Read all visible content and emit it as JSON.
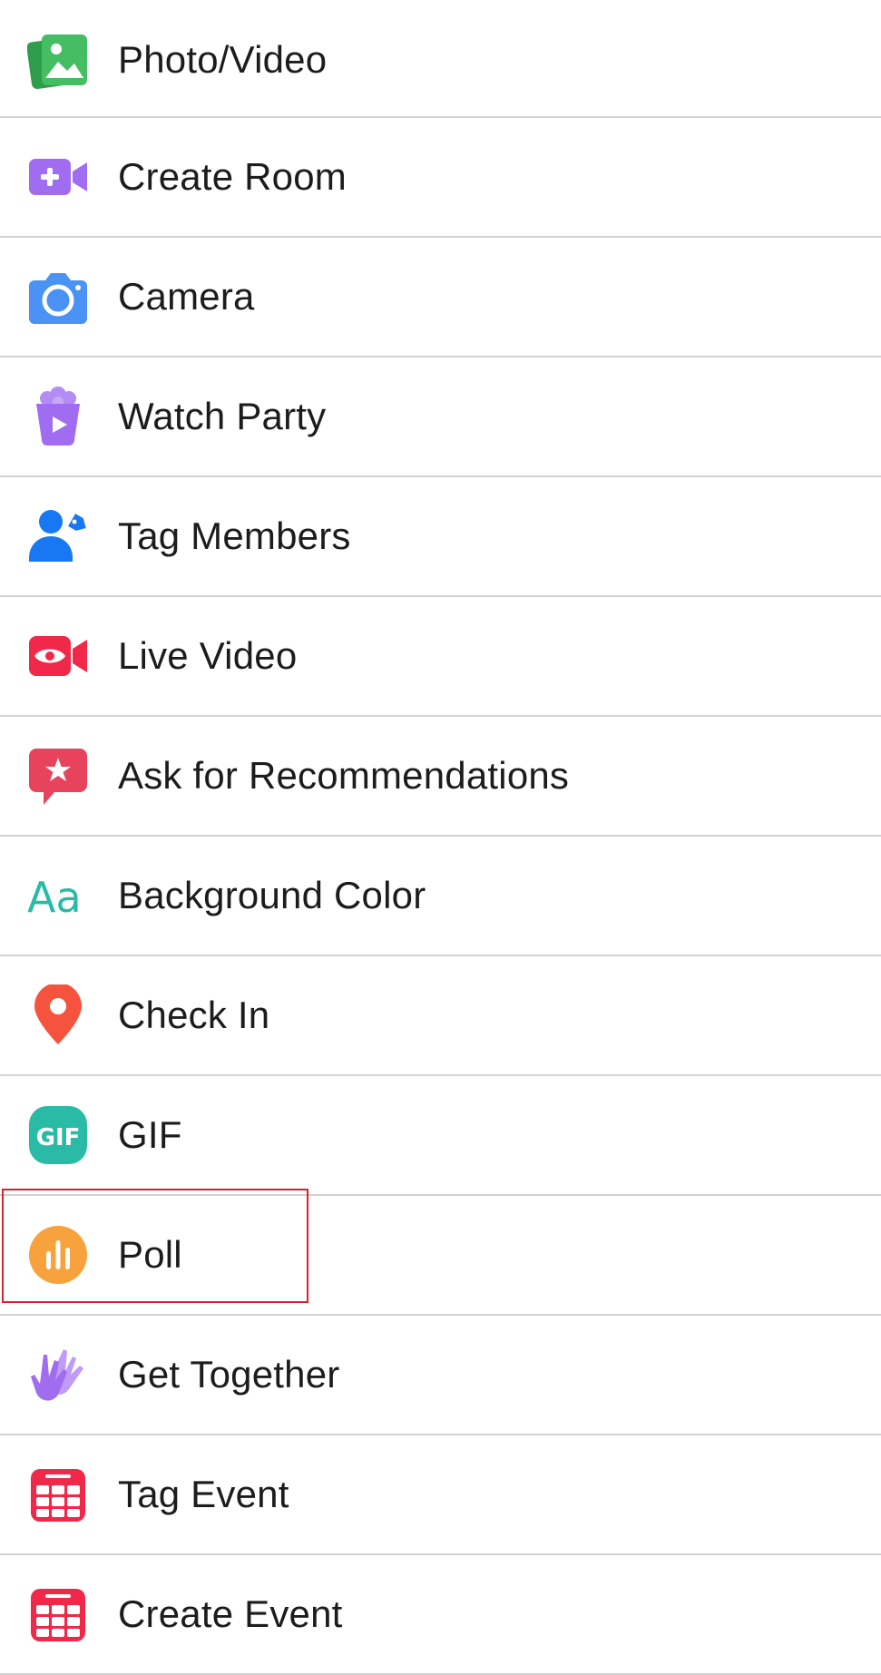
{
  "menu": {
    "items": [
      {
        "label": "Photo/Video",
        "icon": "photo-video-icon",
        "color": "#45bd62"
      },
      {
        "label": "Create Room",
        "icon": "create-room-icon",
        "color": "#a06cf0"
      },
      {
        "label": "Camera",
        "icon": "camera-icon",
        "color": "#4b92f5"
      },
      {
        "label": "Watch Party",
        "icon": "watch-party-icon",
        "color": "#a06cf0"
      },
      {
        "label": "Tag Members",
        "icon": "tag-members-icon",
        "color": "#1877f2"
      },
      {
        "label": "Live Video",
        "icon": "live-video-icon",
        "color": "#f02849"
      },
      {
        "label": "Ask for Recommendations",
        "icon": "recommendations-icon",
        "color": "#e8435d"
      },
      {
        "label": "Background Color",
        "icon": "background-color-icon",
        "color": "#2abba7"
      },
      {
        "label": "Check In",
        "icon": "check-in-icon",
        "color": "#f5533d"
      },
      {
        "label": "GIF",
        "icon": "gif-icon",
        "color": "#2abba7"
      },
      {
        "label": "Poll",
        "icon": "poll-icon",
        "color": "#f7a23c"
      },
      {
        "label": "Get Together",
        "icon": "get-together-icon",
        "color": "#a06cf0"
      },
      {
        "label": "Tag Event",
        "icon": "tag-event-icon",
        "color": "#f02849"
      },
      {
        "label": "Create Event",
        "icon": "create-event-icon",
        "color": "#f02849"
      }
    ],
    "gif_glyph": "GIF",
    "aa_glyph": "Aa"
  },
  "highlighted_item": "Poll"
}
